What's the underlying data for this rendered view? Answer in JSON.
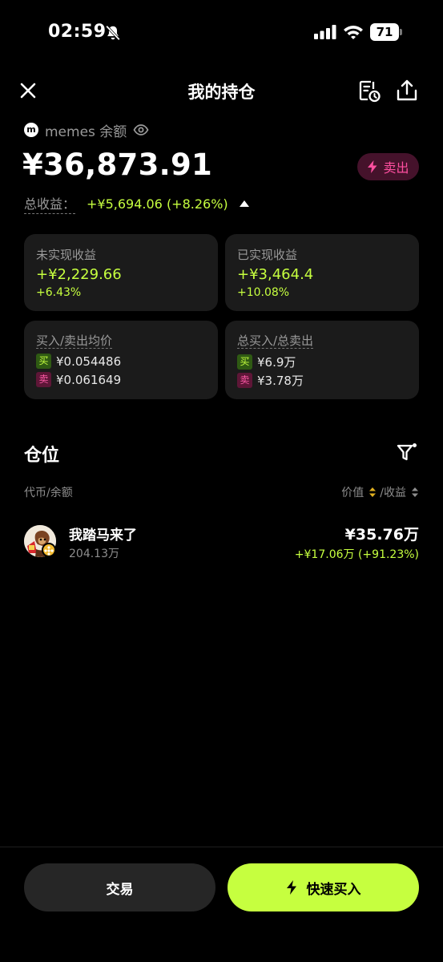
{
  "status_bar": {
    "time": "02:59",
    "battery": "71"
  },
  "nav": {
    "title": "我的持仓"
  },
  "balance": {
    "token_logo": "m",
    "label": "memes 余额",
    "amount": "¥36,873.91",
    "sell_label": "卖出",
    "total_label": "总收益：",
    "total_value": "+¥5,694.06 (+8.26%)"
  },
  "cards": {
    "unrealized": {
      "label": "未实现收益",
      "value": "+¥2,229.66",
      "percent": "+6.43%"
    },
    "realized": {
      "label": "已实现收益",
      "value": "+¥3,464.4",
      "percent": "+10.08%"
    },
    "avg_price": {
      "label": "买入/卖出均价",
      "buy_tag": "买",
      "buy_value": "¥0.054486",
      "sell_tag": "卖",
      "sell_value": "¥0.061649"
    },
    "totals": {
      "label": "总买入/总卖出",
      "buy_tag": "买",
      "buy_value": "¥6.9万",
      "sell_tag": "卖",
      "sell_value": "¥3.78万"
    }
  },
  "positions": {
    "title": "仓位",
    "col_left": "代币/余额",
    "col_value": "价值",
    "col_pnl": "/收益",
    "items": [
      {
        "name": "我踏马来了",
        "qty": "204.13万",
        "value": "¥35.76万",
        "pnl": "+¥17.06万 (+91.23%)"
      }
    ]
  },
  "buttons": {
    "trade": "交易",
    "quick_buy": "快速买入"
  },
  "colors": {
    "accent_green": "#c6ff3f",
    "accent_pink": "#ff4fa0",
    "card_bg": "#1b1b1b"
  }
}
